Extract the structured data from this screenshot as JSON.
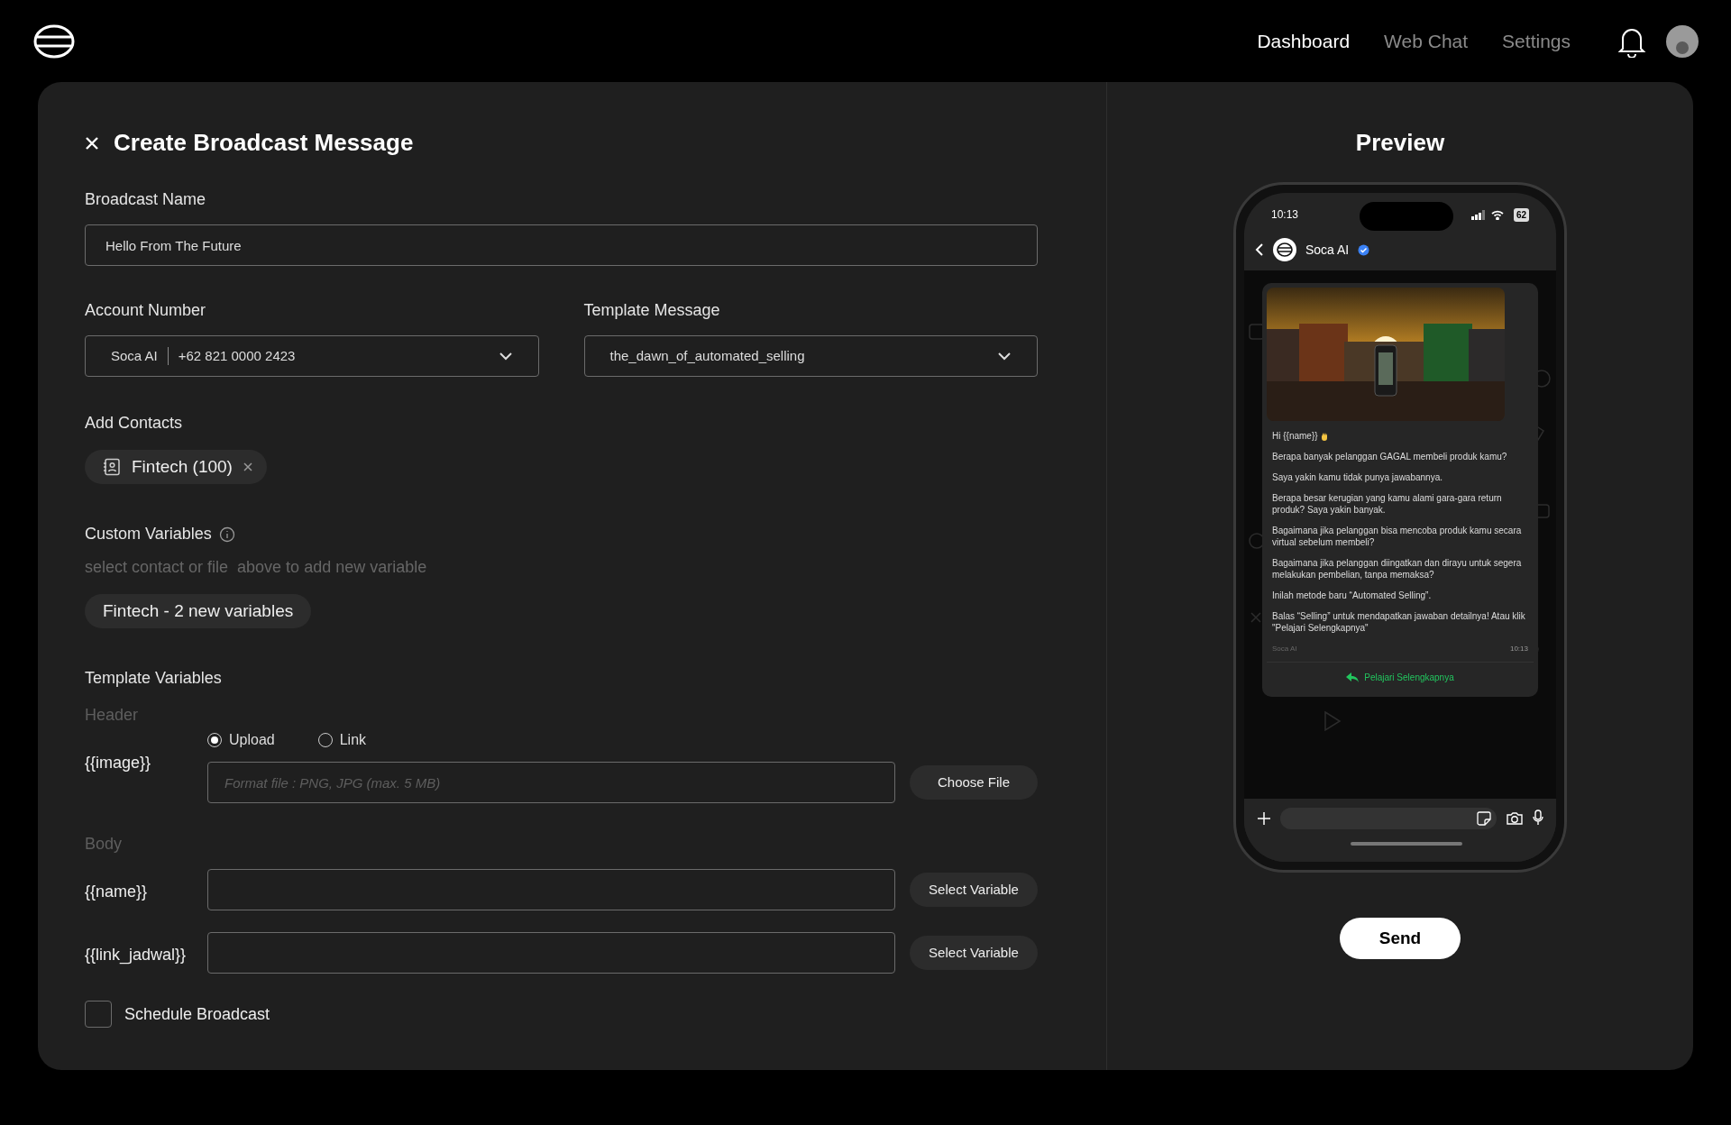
{
  "nav": {
    "items": [
      {
        "label": "Dashboard",
        "selected": true
      },
      {
        "label": "Web Chat",
        "selected": false
      },
      {
        "label": "Settings",
        "selected": false
      }
    ]
  },
  "form": {
    "title": "Create Broadcast Message",
    "broadcast_name": {
      "label": "Broadcast Name",
      "value": "Hello From The Future"
    },
    "account_number": {
      "label": "Account Number",
      "account": "Soca AI",
      "phone": "+62 821 0000 2423"
    },
    "template_message": {
      "label": "Template Message",
      "value": "the_dawn_of_automated_selling"
    },
    "add_contacts": {
      "label": "Add Contacts",
      "chips": [
        {
          "label": "Fintech (100)"
        }
      ]
    },
    "custom_variables": {
      "label": "Custom Variables",
      "hint": "select contact or file  above to add new variable",
      "chips": [
        "Fintech - 2 new variables"
      ]
    },
    "template_variables": {
      "label": "Template Variables",
      "sections": [
        {
          "heading": "Header",
          "rows": [
            {
              "kind": "file",
              "variable": "{{image}}",
              "options": [
                {
                  "label": "Upload",
                  "selected": true
                },
                {
                  "label": "Link",
                  "selected": false
                }
              ],
              "placeholder": "Format file : PNG, JPG (max. 5 MB)",
              "button": "Choose File"
            }
          ]
        },
        {
          "heading": "Body",
          "rows": [
            {
              "kind": "text",
              "variable": "{{name}}",
              "button": "Select Variable"
            },
            {
              "kind": "text",
              "variable": "{{link_jadwal}}",
              "button": "Select Variable"
            }
          ]
        }
      ]
    },
    "schedule": {
      "label": "Schedule Broadcast",
      "checked": false
    }
  },
  "preview": {
    "title": "Preview",
    "phone": {
      "time": "10:13",
      "battery": "62",
      "contact": "Soca AI",
      "message": {
        "greeting": "Hi {{name}}",
        "paragraphs": [
          "Berapa banyak pelanggan GAGAL membeli produk kamu?",
          "Saya yakin kamu tidak punya jawabannya.",
          "Berapa besar kerugian yang kamu alami gara-gara return produk? Saya yakin banyak.",
          "Bagaimana jika pelanggan bisa mencoba produk kamu secara virtual sebelum membeli?",
          "Bagaimana jika pelanggan diingatkan dan dirayu untuk segera melakukan pembelian, tanpa memaksa?",
          "Inilah metode baru “Automated Selling”.",
          "Balas “Selling” untuk mendapatkan jawaban detailnya! Atau klik \"Pelajari Selengkapnya\""
        ],
        "sender": "Soca AI",
        "time": "10:13",
        "button": "Pelajari Selengkapnya"
      }
    },
    "send": "Send"
  }
}
